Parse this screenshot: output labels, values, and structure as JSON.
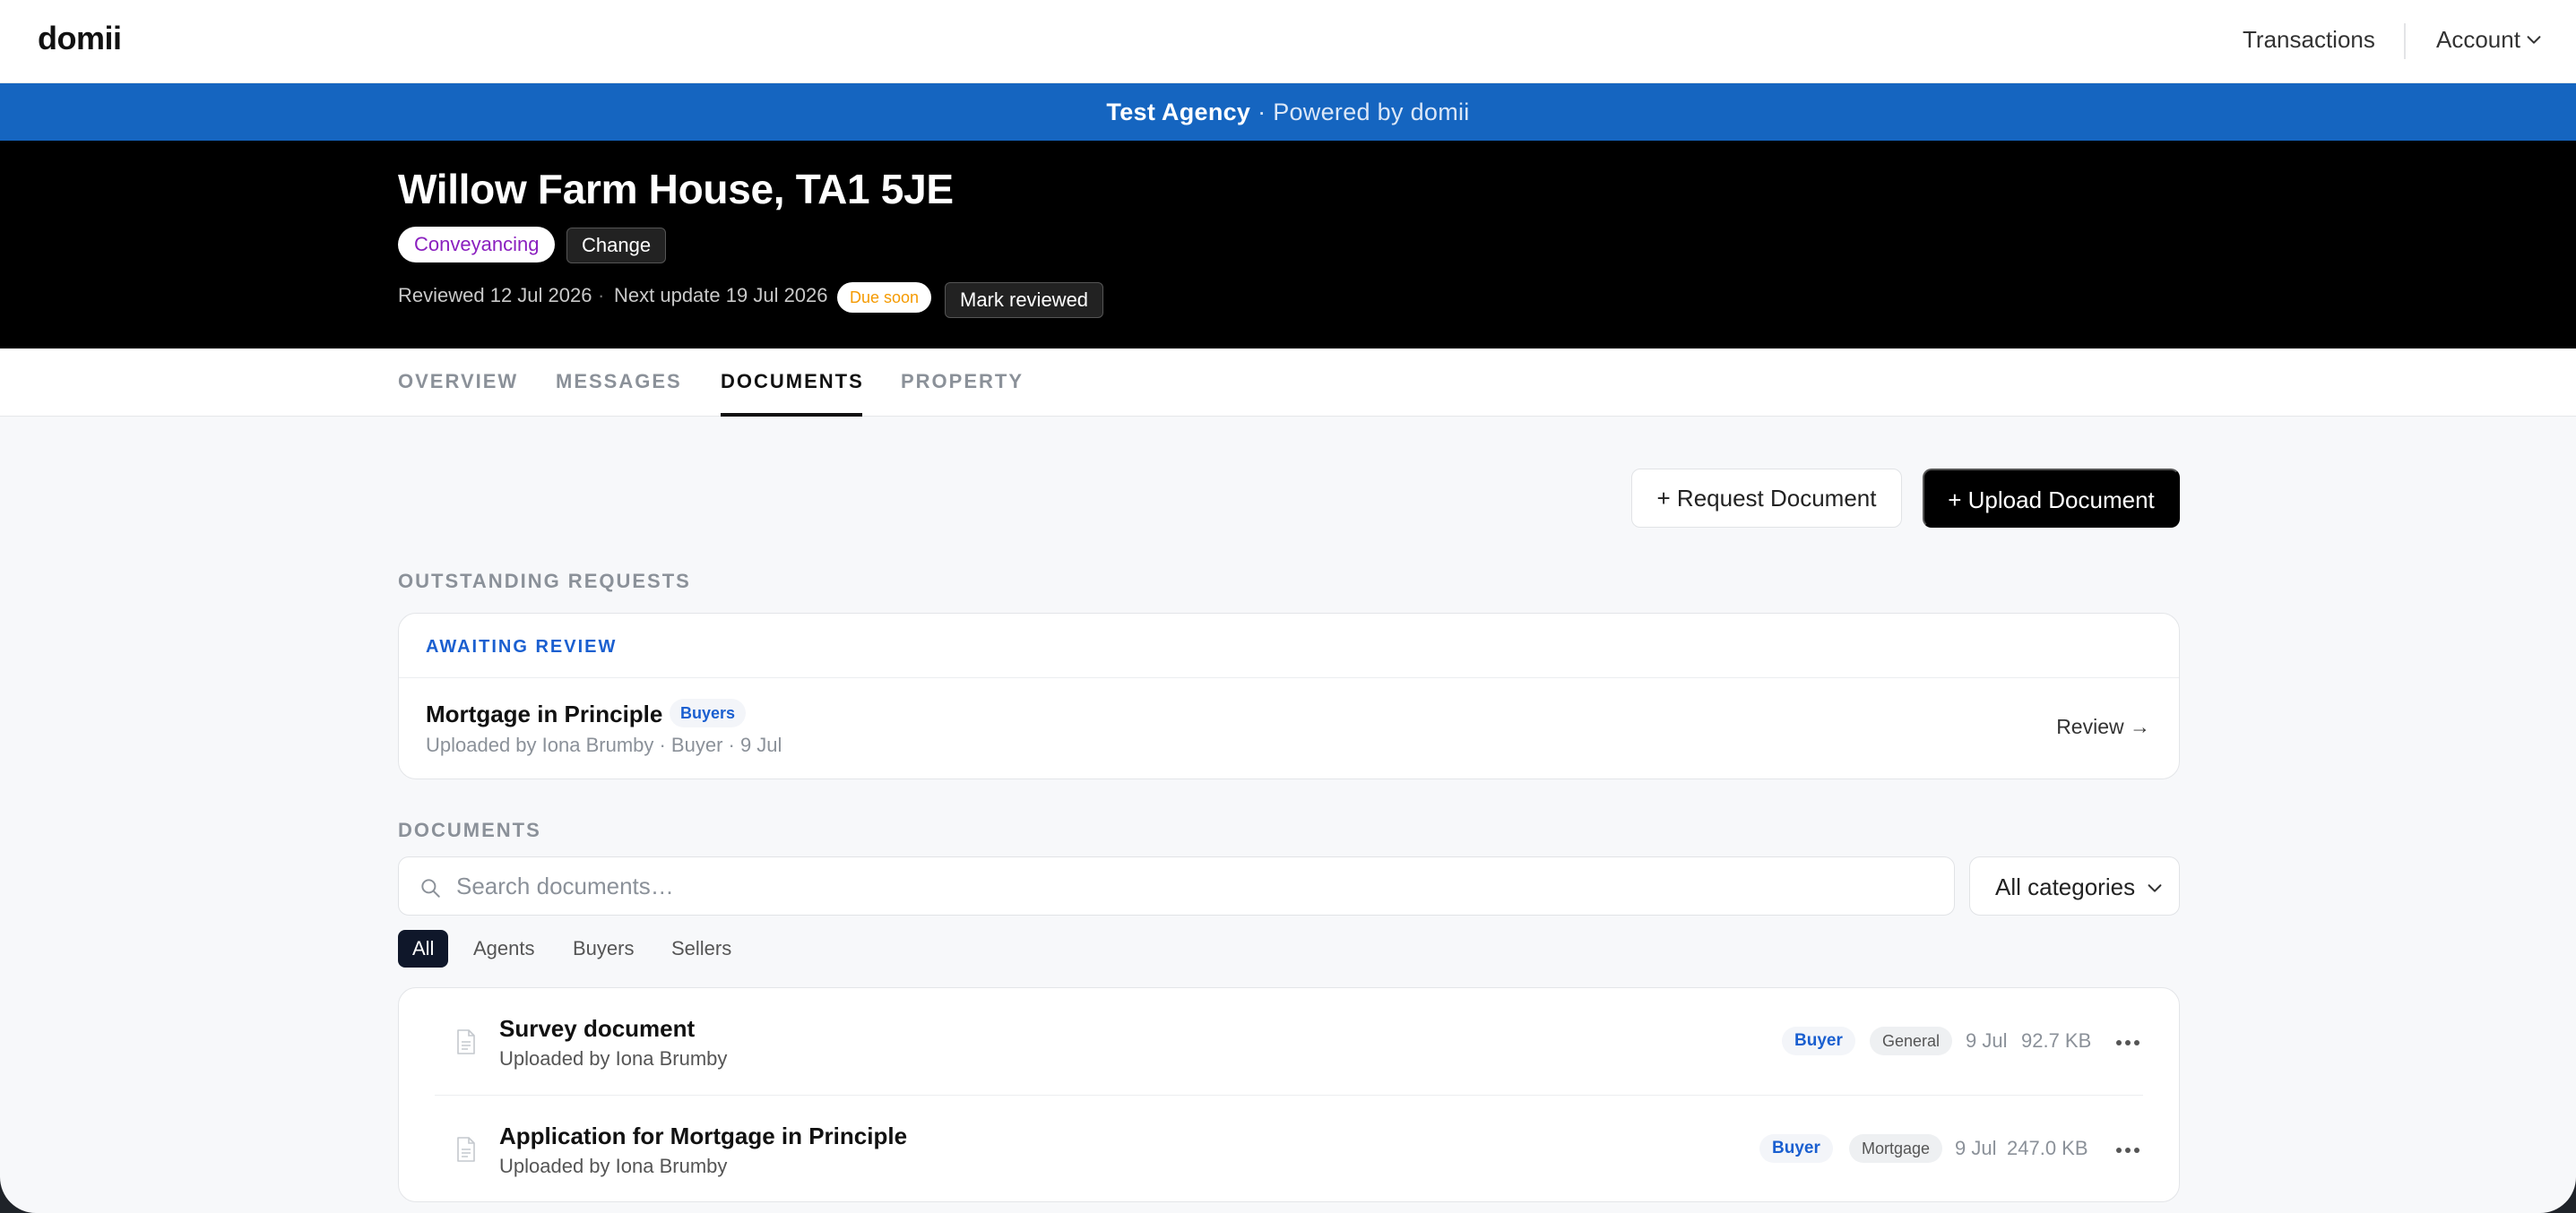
{
  "nav": {
    "logo": "domii",
    "transactions": "Transactions",
    "account": "Account"
  },
  "banner": {
    "agency": "Test Agency",
    "separator": "·",
    "powered": "Powered by domii"
  },
  "hero": {
    "title": "Willow Farm House, TA1 5JE",
    "service": "Conveyancing",
    "change": "Change",
    "reviewed": "Reviewed 12 Jul 2026",
    "separator": "·",
    "next_update": "Next update 19 Jul 2026",
    "due": "Due soon",
    "mark_reviewed": "Mark reviewed"
  },
  "tabs": [
    "OVERVIEW",
    "MESSAGES",
    "DOCUMENTS",
    "PROPERTY"
  ],
  "active_tab": "DOCUMENTS",
  "actions": {
    "request": "+ Request Document",
    "upload": "+ Upload Document"
  },
  "outstanding": {
    "heading": "OUTSTANDING REQUESTS",
    "status": "AWAITING REVIEW",
    "item": {
      "title": "Mortgage in Principle",
      "badge": "Buyers",
      "meta": "Uploaded by Iona Brumby · Buyer · 9 Jul",
      "action": "Review →"
    }
  },
  "documents": {
    "heading": "DOCUMENTS",
    "search_placeholder": "Search documents…",
    "category_select": "All categories",
    "filters": [
      "All",
      "Agents",
      "Buyers",
      "Sellers"
    ],
    "active_filter": "All",
    "items": [
      {
        "title": "Survey document",
        "uploader": "Uploaded by Iona Brumby",
        "party": "Buyer",
        "category": "General",
        "date": "9 Jul",
        "size": "92.7 KB"
      },
      {
        "title": "Application for Mortgage in Principle",
        "uploader": "Uploaded by Iona Brumby",
        "party": "Buyer",
        "category": "Mortgage",
        "date": "9 Jul",
        "size": "247.0 KB"
      }
    ]
  },
  "colors": {
    "banner": "#1565c0",
    "accent_blue": "#1a5fd0",
    "conveyancing": "#8a1fbf",
    "due_soon": "#f59a00",
    "primary_button": "#000000"
  },
  "icons": {
    "account": "chevron-down-icon",
    "search": "search-icon",
    "select": "chevron-down-icon",
    "document": "document-icon",
    "more": "more-horizontal-icon"
  }
}
